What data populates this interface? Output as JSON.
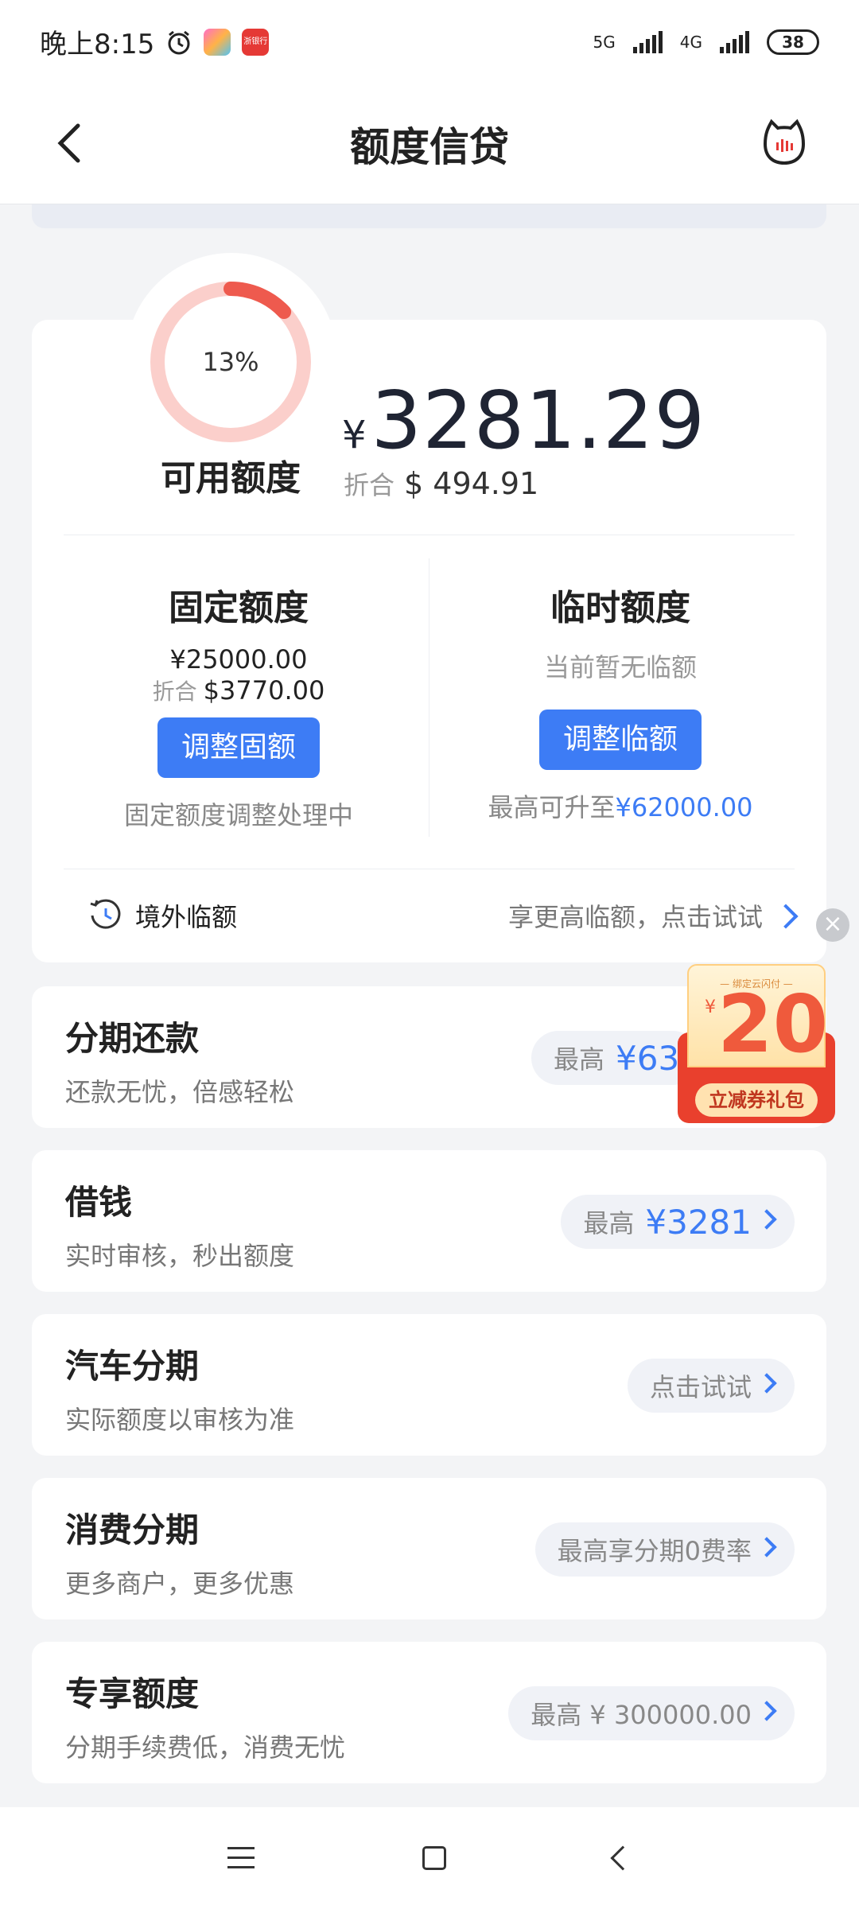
{
  "status_bar": {
    "time": "晚上8:15",
    "net1": "5G",
    "net2": "4G",
    "battery": "38",
    "app2_label": "浙银行"
  },
  "header": {
    "title": "额度信贷"
  },
  "credit": {
    "usage_percent_label": "13%",
    "usage_fraction": 0.13,
    "available_label": "可用额度",
    "currency_symbol": "¥",
    "available_amount": "3281.29",
    "usd_prefix": "折合",
    "usd_amount": "$ 494.91"
  },
  "fixed": {
    "title": "固定额度",
    "amount": "¥25000.00",
    "usd_prefix": "折合",
    "usd_amount": "$3770.00",
    "button": "调整固额",
    "note": "固定额度调整处理中"
  },
  "temporary": {
    "title": "临时额度",
    "status": "当前暂无临额",
    "button": "调整临额",
    "note_prefix": "最高可升至",
    "note_value": "¥62000.00"
  },
  "overseas": {
    "label": "境外临额",
    "hint": "享更高临额，点击试试"
  },
  "products": [
    {
      "title": "分期还款",
      "subtitle": "还款无忧，倍感轻松",
      "pill_prefix": "最高",
      "pill_value": "¥63"
    },
    {
      "title": "借钱",
      "subtitle": "实时审核，秒出额度",
      "pill_prefix": "最高",
      "pill_value": "¥3281"
    },
    {
      "title": "汽车分期",
      "subtitle": "实际额度以审核为准",
      "pill_prefix": "点击试试",
      "pill_value": ""
    },
    {
      "title": "消费分期",
      "subtitle": "更多商户，更多优惠",
      "pill_prefix": "最高享分期0费率",
      "pill_value": ""
    },
    {
      "title": "专享额度",
      "subtitle": "分期手续费低，消费无忧",
      "pill_prefix": "最高 ¥ 300000.00",
      "pill_value": ""
    }
  ],
  "coupon": {
    "caption": "— 绑定云闪付 —",
    "yen": "¥",
    "value": "20",
    "tag": "立减券礼包"
  },
  "colors": {
    "accent": "#3d7cf5",
    "ring_track": "#fbcfcb",
    "ring_fill": "#ee5a4e",
    "coupon_red": "#e9402d"
  }
}
